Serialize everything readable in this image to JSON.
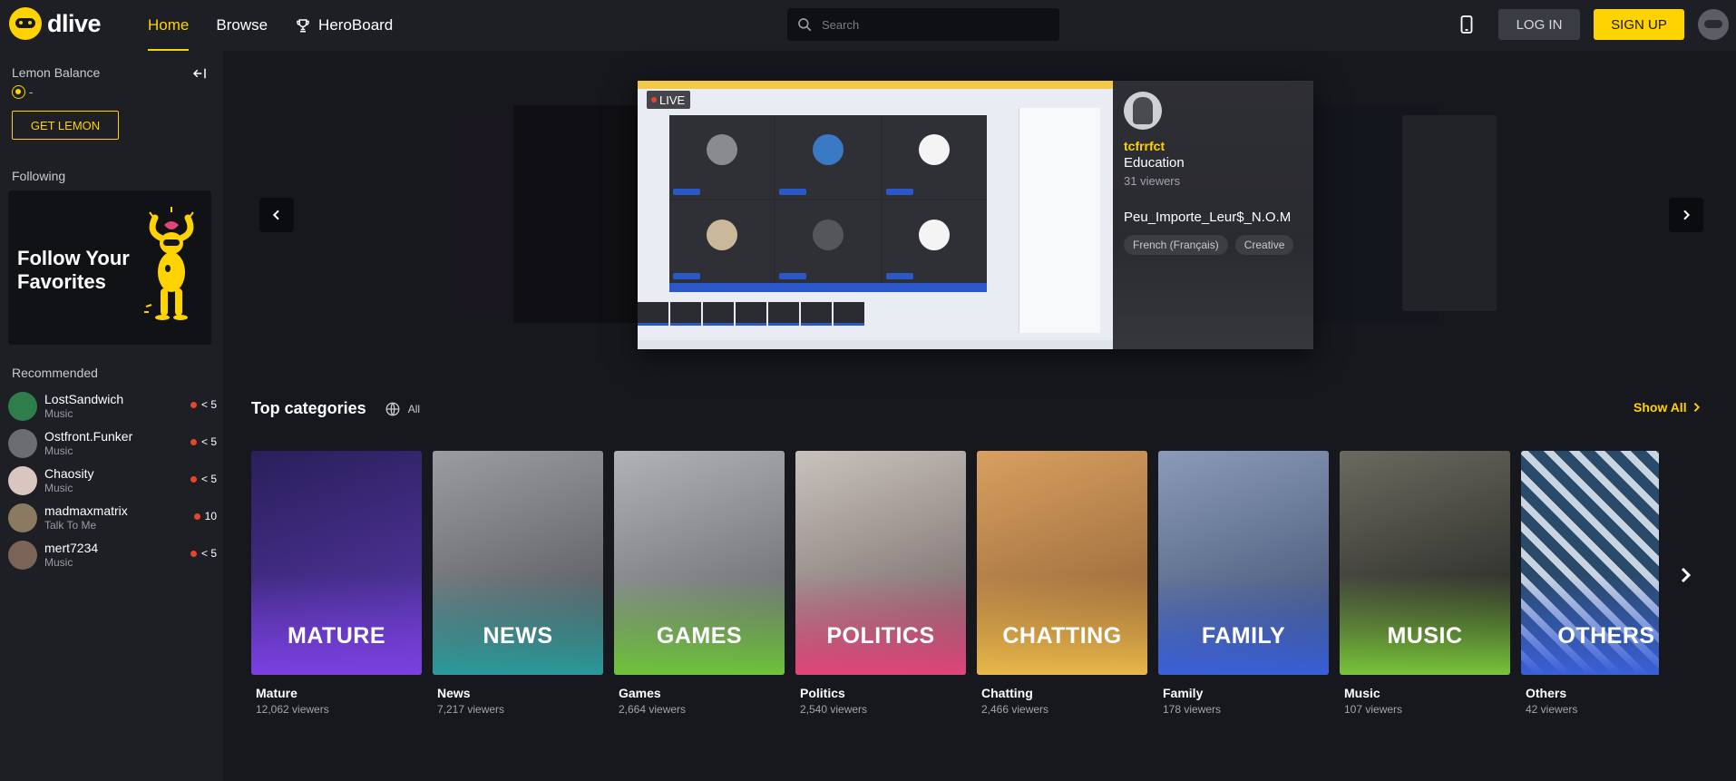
{
  "app": {
    "logo_text": "dlive"
  },
  "nav": [
    {
      "label": "Home",
      "active": true
    },
    {
      "label": "Browse",
      "active": false
    },
    {
      "label": "HeroBoard",
      "active": false
    }
  ],
  "search": {
    "placeholder": "Search"
  },
  "header": {
    "login_label": "LOG IN",
    "signup_label": "SIGN UP"
  },
  "sidebar": {
    "lemon_label": "Lemon Balance",
    "lemon_value": "-",
    "get_lemon_label": "GET LEMON",
    "following_label": "Following",
    "follow_promo": "Follow Your Favorites",
    "recommended_label": "Recommended",
    "recommended": [
      {
        "name": "LostSandwich",
        "category": "Music",
        "viewers": "< 5",
        "color": "#2f7d4a"
      },
      {
        "name": "Ostfront.Funker",
        "category": "Music",
        "viewers": "< 5",
        "color": "#6b6d72"
      },
      {
        "name": "Chaosity",
        "category": "Music",
        "viewers": "< 5",
        "color": "#d9c6c0"
      },
      {
        "name": "madmaxmatrix",
        "category": "Talk To Me",
        "viewers": "10",
        "color": "#8a7a62"
      },
      {
        "name": "mert7234",
        "category": "Music",
        "viewers": "< 5",
        "color": "#7a6458"
      }
    ]
  },
  "featured": {
    "live_label": "LIVE",
    "username": "tcfrrfct",
    "category": "Education",
    "viewers": "31 viewers",
    "title": "Peu_Importe_Leur$_N.O.M",
    "tags": [
      "French (Français)",
      "Creative"
    ]
  },
  "categories": {
    "title": "Top categories",
    "filter_label": "All",
    "show_all_label": "Show All",
    "items": [
      {
        "banner": "MATURE",
        "name": "Mature",
        "viewers": "12,062 viewers",
        "bg": "#3a2a6e",
        "accent": "#7b3fe0"
      },
      {
        "banner": "NEWS",
        "name": "News",
        "viewers": "7,217 viewers",
        "bg": "#6b6e74",
        "accent": "#2a9a9a"
      },
      {
        "banner": "GAMES",
        "name": "Games",
        "viewers": "2,664 viewers",
        "bg": "#8a8c92",
        "accent": "#6fc43a"
      },
      {
        "banner": "POLITICS",
        "name": "Politics",
        "viewers": "2,540 viewers",
        "bg": "#8f8a86",
        "accent": "#e0457a"
      },
      {
        "banner": "CHATTING",
        "name": "Chatting",
        "viewers": "2,466 viewers",
        "bg": "#c88a4a",
        "accent": "#e8b84a"
      },
      {
        "banner": "FAMILY",
        "name": "Family",
        "viewers": "178 viewers",
        "bg": "#5a6a8a",
        "accent": "#3a5fd8"
      },
      {
        "banner": "MUSIC",
        "name": "Music",
        "viewers": "107 viewers",
        "bg": "#4a4a44",
        "accent": "#7ac43a"
      },
      {
        "banner": "OTHERS",
        "name": "Others",
        "viewers": "42 viewers",
        "bg": "#3a5a7a",
        "accent": "#3a5fd8"
      }
    ]
  },
  "colors": {
    "accent": "#ffd300",
    "live": "#e8432d",
    "background": "#17181d"
  }
}
